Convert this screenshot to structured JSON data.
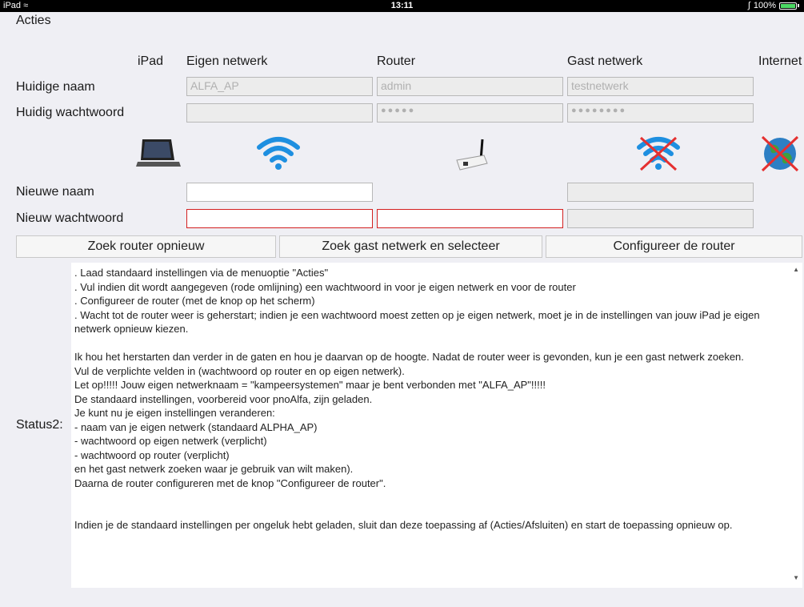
{
  "status_bar": {
    "device": "iPad",
    "time": "13:11",
    "battery": "100%"
  },
  "menu": {
    "label": "Acties"
  },
  "columns": {
    "ipad": "iPad",
    "eigen": "Eigen netwerk",
    "router": "Router",
    "gast": "Gast netwerk",
    "internet": "Internet"
  },
  "rows": {
    "huidige_naam": "Huidige naam",
    "huidig_wachtwoord": "Huidig wachtwoord",
    "nieuwe_naam": "Nieuwe naam",
    "nieuw_wachtwoord": "Nieuw wachtwoord"
  },
  "fields": {
    "eigen_naam": "ALFA_AP",
    "router_naam": "admin",
    "gast_naam": "testnetwerk",
    "eigen_ww": "",
    "router_ww": "●●●●●",
    "gast_ww": "●●●●●●●●"
  },
  "icons": {
    "ipad": "ipad-icon",
    "wifi": "wifi-icon",
    "router": "router-icon",
    "wifi_disabled": "wifi-disabled-icon",
    "globe_disabled": "globe-disabled-icon"
  },
  "buttons": {
    "zoek_router": "Zoek router opnieuw",
    "zoek_gast": "Zoek gast netwerk en selecteer",
    "configureer": "Configureer de router"
  },
  "status": {
    "label": "Status2:",
    "lines": [
      ". Laad standaard instellingen via de menuoptie \"Acties\"",
      ". Vul indien dit wordt aangegeven (rode omlijning) een wachtwoord in voor je eigen netwerk en voor de router",
      ". Configureer de router (met de knop op het scherm)",
      ". Wacht tot de router weer is geherstart; indien je een wachtwoord moest zetten op je eigen netwerk, moet je in de instellingen van jouw iPad je eigen netwerk opnieuw kiezen.",
      "",
      "Ik hou het herstarten dan verder in de gaten en hou je daarvan op de hoogte. Nadat de router weer is gevonden, kun je een gast netwerk zoeken.",
      "Vul de verplichte velden in (wachtwoord op router en op eigen netwerk).",
      "Let op!!!!! Jouw eigen netwerknaam = \"kampeersystemen\" maar je bent verbonden met \"ALFA_AP\"!!!!!",
      "De standaard instellingen, voorbereid voor pnoAlfa, zijn geladen.",
      "Je kunt nu je eigen instellingen veranderen:",
      "- naam van je eigen netwerk (standaard ALPHA_AP)",
      "- wachtwoord op eigen netwerk (verplicht)",
      "- wachtwoord op router (verplicht)",
      "en het gast netwerk zoeken waar je gebruik van wilt maken).",
      "Daarna de router configureren met de knop \"Configureer de router\".",
      "",
      "",
      "Indien je de standaard instellingen per ongeluk hebt geladen, sluit dan deze toepassing af (Acties/Afsluiten) en start de toepassing opnieuw op."
    ]
  },
  "colors": {
    "required_border": "#d32020",
    "background": "#efeff4",
    "battery": "#4cd964"
  }
}
